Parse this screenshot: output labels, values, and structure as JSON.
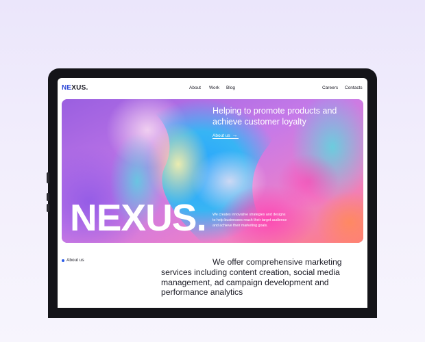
{
  "brand": {
    "logo_part1": "NE",
    "logo_part2": "XUS.",
    "wordmark": "NEXUS."
  },
  "nav": {
    "about": "About",
    "work": "Work",
    "blog": "Blog",
    "careers": "Careers",
    "contacts": "Contacts"
  },
  "hero": {
    "headline": "Helping to promote products and achieve customer loyalty",
    "about_link": "About us",
    "arrow_icon": "→",
    "description": "We creates innovative strategies and designs to help businesses reach their target audience and achieve their marketing goals."
  },
  "section": {
    "marker_label": "About us",
    "services_text": "We offer comprehensive marketing services including content creation, social media management, ad campaign development and performance analytics"
  },
  "colors": {
    "accent_blue": "#2742d6",
    "text_dark": "#1a1a24",
    "background": "#efebfc",
    "device_frame": "#141419"
  }
}
